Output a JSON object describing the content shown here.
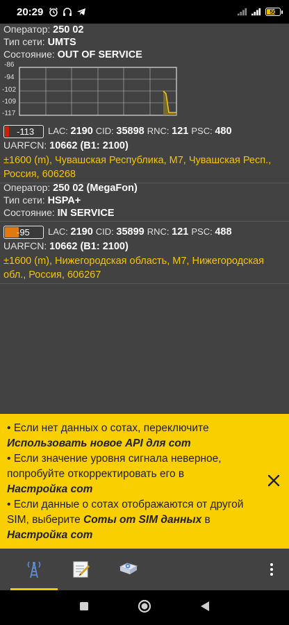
{
  "status_bar": {
    "time": "20:29",
    "icons_left": [
      "alarm-icon",
      "headphones-icon",
      "telegram-icon"
    ],
    "icons_right": [
      "signal-icon",
      "signal-2-icon",
      "battery-icon"
    ],
    "battery_level": "50"
  },
  "cell1": {
    "operator_label": "Оператор:",
    "operator_value": "250 02",
    "network_label": "Тип сети:",
    "network_value": "UMTS",
    "state_label": "Состояние:",
    "state_value": "OUT OF SERVICE",
    "graph": {
      "y_ticks": [
        "-86",
        "-94",
        "-102",
        "-109",
        "-117"
      ],
      "line_color": "#f5c400"
    },
    "signal": {
      "value": "-113",
      "level_fraction": 0.1,
      "color": "#cc2200"
    },
    "lac_label": "LAC:",
    "lac": "2190",
    "cid_label": "CID:",
    "cid": "35898",
    "rnc_label": "RNC:",
    "rnc": "121",
    "psc_label": "PSC:",
    "psc": "480",
    "uarfcn_label": "UARFCN:",
    "uarfcn": "10662 (B1: 2100)",
    "address": "±1600 (m), Чувашская Республика, М7, Чувашская Респ., Россия, 606268"
  },
  "cell2": {
    "operator_label": "Оператор:",
    "operator_value": "250 02 (MegaFon)",
    "network_label": "Тип сети:",
    "network_value": "HSPA+",
    "state_label": "Состояние:",
    "state_value": "IN SERVICE",
    "signal": {
      "value": "-95",
      "level_fraction": 0.35,
      "color": "#e07a10"
    },
    "lac_label": "LAC:",
    "lac": "2190",
    "cid_label": "CID:",
    "cid": "35899",
    "rnc_label": "RNC:",
    "rnc": "121",
    "psc_label": "PSC:",
    "psc": "488",
    "uarfcn_label": "UARFCN:",
    "uarfcn": "10662 (B1: 2100)",
    "address": "±1600 (m), Нижегородская область, М7, Нижегородская обл., Россия, 606267"
  },
  "tips": {
    "tip1_text": "• Если нет данных о сотах, переключите",
    "tip1_bold": "Использовать новое API для сот",
    "tip2_text": "• Если значение уровня сигнала неверное, попробуйте откорректировать его в",
    "tip2_bold": "Настройка сот",
    "tip3_text": "• Если данные о сотах отображаются от другой SIM, выберите",
    "tip3_bold": "Соты от SIM данных",
    "tip3_mid": "в",
    "tip3_bold2": "Настройка сот"
  },
  "toolbar": {
    "items": [
      "cell-tower-icon",
      "log-icon",
      "map-icon"
    ],
    "more_icon": "more-vert-icon"
  },
  "navbar": {
    "items": [
      "recents-square-icon",
      "home-circle-icon",
      "back-triangle-icon"
    ]
  },
  "colors": {
    "accent": "#f5c400",
    "background": "#424242",
    "tips_bg": "#f9cf00"
  }
}
